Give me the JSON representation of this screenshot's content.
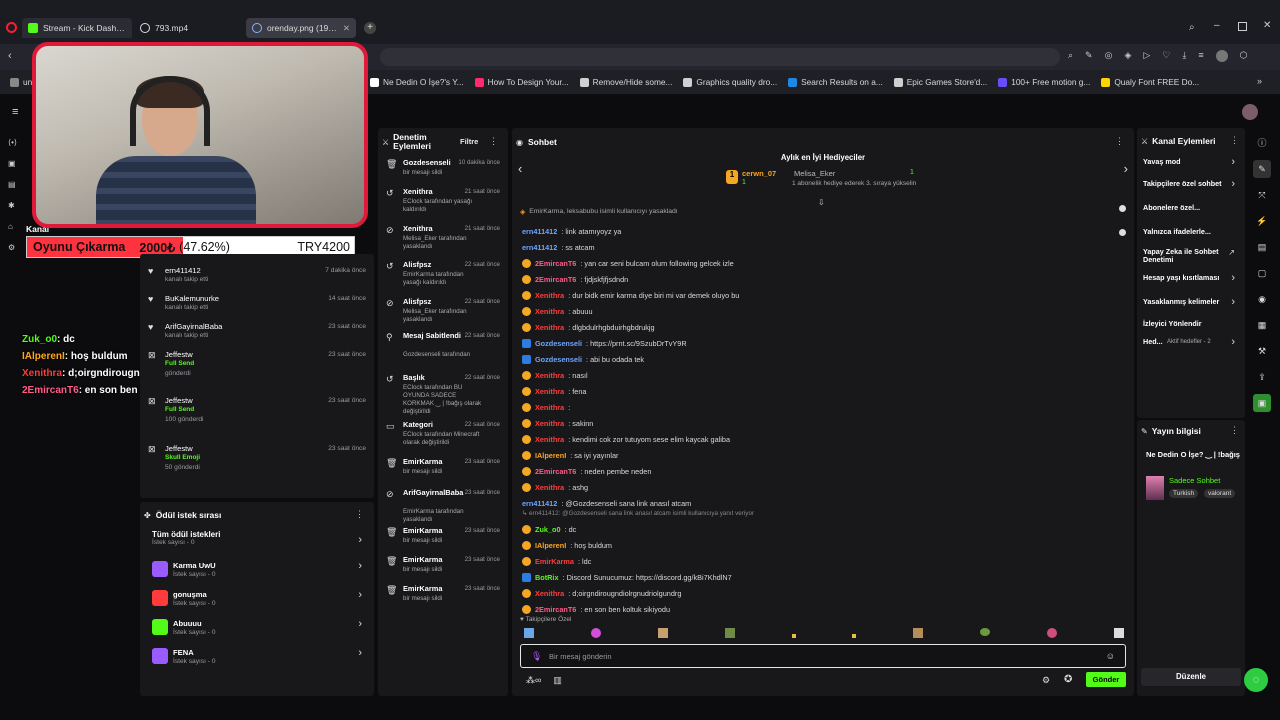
{
  "browser": {
    "tabs": [
      {
        "title": "Stream - Kick Dashboard",
        "color": "#53fc18"
      },
      {
        "title": "793.mp4",
        "color": "#ffffff"
      },
      {
        "title": "orenday.png (1917×10",
        "color": "#8ab4f8"
      }
    ],
    "new_tab": "+",
    "bookmarks": [
      {
        "label": "un",
        "color": "#888888"
      },
      {
        "label": "Ne Dedin O İşe?'s Y...",
        "color": "#ffffff"
      },
      {
        "label": "How To Design Your...",
        "color": "#ff2b6e"
      },
      {
        "label": "Remove/Hide some...",
        "color": "#d0d0d0"
      },
      {
        "label": "Graphics quality dro...",
        "color": "#d0d0d0"
      },
      {
        "label": "Search Results on a...",
        "color": "#1e88e5"
      },
      {
        "label": "Epic Games Store'd...",
        "color": "#cfcfcf"
      },
      {
        "label": "100+ Free motion g...",
        "color": "#6a4cff"
      },
      {
        "label": "Qualy Font FREE Do...",
        "color": "#ffd500"
      }
    ]
  },
  "overlay": {
    "goal_title": "Oyunu Çıkarma",
    "goal_amount": "2000₺",
    "goal_percent": "(47.62%)",
    "goal_target": "TRY4200",
    "goal_progress": 0.4762,
    "chat": [
      {
        "user": "Zuk_o0",
        "text": ": dc",
        "color": "#53fc18"
      },
      {
        "user": "IAlperenI",
        "text": ": hoş buldum",
        "color": "#ffa51f"
      },
      {
        "user": "Xenithra",
        "text": ": d;oirgndirougndiolrgnudriolgundrg",
        "color": "#ff3d3d"
      },
      {
        "user": "2EmircanT6",
        "text": ": en son ben koltuk sikiyodu",
        "color": "#ff5c8a"
      }
    ]
  },
  "left_panel": {
    "kanal_label": "Kanal",
    "activity": [
      {
        "user": "ern411412",
        "action": "kanalı takip etti",
        "extra": "",
        "time": "7 dakika önce",
        "icon": "heart"
      },
      {
        "user": "BuKalemunurke",
        "action": "kanalı takip etti",
        "extra": "",
        "time": "14 saat önce",
        "icon": "heart"
      },
      {
        "user": "ArifGayirnalBaba",
        "action": "kanalı takip etti",
        "extra": "",
        "time": "23 saat önce",
        "icon": "heart"
      },
      {
        "user": "Jeffestw",
        "action": "Full Send",
        "extra": "gönderdi",
        "time": "23 saat önce",
        "icon": "x"
      },
      {
        "user": "Jeffestw",
        "action": "Full Send",
        "extra": "100 gönderdi",
        "time": "23 saat önce",
        "icon": "x"
      },
      {
        "user": "Jeffestw",
        "action": "Skull Emoji",
        "extra": "50 gönderdi",
        "time": "23 saat önce",
        "icon": "x"
      }
    ],
    "rewards_title": "Ödül istek sırası",
    "rewards_all": "Tüm ödül istekleri",
    "rewards_all_sub": "İstek sayısı - 0",
    "rewards": [
      {
        "name": "Karma UwU",
        "sub": "İstek sayısı - 0",
        "color": "#9b5cff"
      },
      {
        "name": "gonuşma",
        "sub": "İstek sayısı - 0",
        "color": "#ff3b3b"
      },
      {
        "name": "Abuuuu",
        "sub": "İstek sayısı - 0",
        "color": "#53fc18"
      },
      {
        "name": "FENA",
        "sub": "İstek sayısı - 0",
        "color": "#9b5cff"
      }
    ]
  },
  "moderation": {
    "title": "Denetim Eylemleri",
    "filter": "Filtre",
    "items": [
      {
        "title": "Gozdesenseli",
        "desc": "bir mesajı sildi",
        "time": "10 dakika önce",
        "icon": "trash"
      },
      {
        "title": "Xenithra",
        "desc": "EClock tarafından yasağı kaldırıldı",
        "time": "21 saat önce",
        "icon": "undo"
      },
      {
        "title": "Xenithra",
        "desc": "Melisa_Eker tarafından yasaklandı",
        "time": "21 saat önce",
        "icon": "ban"
      },
      {
        "title": "Alisfpsz",
        "desc": "EmirKarma tarafından yasağı kaldırıldı",
        "time": "22 saat önce",
        "icon": "undo"
      },
      {
        "title": "Alisfpsz",
        "desc": "Melisa_Eker tarafından yasaklandı",
        "time": "22 saat önce",
        "icon": "ban"
      },
      {
        "title": "Mesaj Sabitlendi",
        "desc": "Gozdesenseli tarafından",
        "time": "22 saat önce",
        "icon": "pin"
      },
      {
        "title": "Başlık",
        "desc": "EClock tarafından BU OYUNDA SADECE KORKMAK ‿ | !bağış olarak değiştirildi",
        "time": "22 saat önce",
        "icon": "undo"
      },
      {
        "title": "Kategori",
        "desc": "EClock tarafından Minecraft olarak değiştirildi",
        "time": "22 saat önce",
        "icon": "tv"
      },
      {
        "title": "EmirKarma",
        "desc": "bir mesajı sildi",
        "time": "23 saat önce",
        "icon": "trash"
      },
      {
        "title": "ArifGayirnalBaba",
        "desc": "EmirKarma tarafından yasaklandı",
        "time": "23 saat önce",
        "icon": "ban"
      },
      {
        "title": "EmirKarma",
        "desc": "bir mesajı sildi",
        "time": "23 saat önce",
        "icon": "trash"
      },
      {
        "title": "EmirKarma",
        "desc": "bir mesajı sildi",
        "time": "23 saat önce",
        "icon": "trash"
      },
      {
        "title": "EmirKarma",
        "desc": "bir mesajı sildi",
        "time": "23 saat önce",
        "icon": "trash"
      }
    ]
  },
  "chat": {
    "title": "Sohbet",
    "gifter_title": "Aylık en İyi Hediyeciler",
    "top1_user": "cerwn_07",
    "top1_count": "1",
    "top2_user": "Melisa_Eker",
    "top2_count": "1",
    "top2_note": "1 abonelik hediye ederek 3. sıraya yükselin",
    "system": "EmirKarma, leksabubu isimli kullanıcıyı yasakladı",
    "messages": [
      {
        "user": "ern411412",
        "text": ": link atamıyoyz ya",
        "color": "u-blue"
      },
      {
        "user": "ern411412",
        "text": ": ss atcam",
        "color": "u-blue"
      },
      {
        "user": "2EmircanT6",
        "text": ": yan car seni bulcam olum following gelcek izle",
        "color": "u-pink"
      },
      {
        "user": "2EmircanT6",
        "text": ": fjdjskfjfjsdndn",
        "color": "u-pink"
      },
      {
        "user": "Xenithra",
        "text": ": dur bidk emir karma diye biri mi var demek oluyo bu",
        "color": "u-red"
      },
      {
        "user": "Xenithra",
        "text": ": abuuu",
        "color": "u-red"
      },
      {
        "user": "Xenithra",
        "text": ": dlgbdulrhgbduirhgbdrukjg",
        "color": "u-red"
      },
      {
        "user": "Gozdesenseli",
        "text": ": https://prnt.sc/9SzubDrTvY9R",
        "color": "u-blue"
      },
      {
        "user": "Gozdesenseli",
        "text": ": abi bu odada tek",
        "color": "u-blue"
      },
      {
        "user": "Xenithra",
        "text": ": nasıl",
        "color": "u-red"
      },
      {
        "user": "Xenithra",
        "text": ": fena",
        "color": "u-red"
      },
      {
        "user": "Xenithra",
        "text": ":",
        "color": "u-red"
      },
      {
        "user": "Xenithra",
        "text": ": sakinn",
        "color": "u-red"
      },
      {
        "user": "Xenithra",
        "text": ": kendimi cok zor tutuyom sese elim kaycak galiba",
        "color": "u-red"
      },
      {
        "user": "IAlperenI",
        "text": ": sa iyi yayınlar",
        "color": "u-orange"
      },
      {
        "user": "2EmircanT6",
        "text": ": neden pembe neden",
        "color": "u-pink"
      },
      {
        "user": "Xenithra",
        "text": ": ashg",
        "color": "u-red"
      },
      {
        "user": "ern411412",
        "text": ": @Gozdesenseli sana link anasıl atcam",
        "color": "u-blue"
      }
    ],
    "reply_note": "ern411412: @Gozdesenseli sana link anasıl atcam isimli kullanıcıya yanıt veriyor",
    "messages2": [
      {
        "user": "Zuk_o0",
        "text": ": dc",
        "color": "u-green"
      },
      {
        "user": "IAlperenI",
        "text": ": hoş buldum",
        "color": "u-orange"
      },
      {
        "user": "EmirKarma",
        "text": ": ldc",
        "color": "u-red"
      },
      {
        "user": "BotRix",
        "text": ": Discord Sunucumuz: https://discord.gg/kBi7KhdlN7",
        "color": "u-green"
      },
      {
        "user": "Xenithra",
        "text": ": d;oirgndirougndiolrgnudriolgundrg",
        "color": "u-red"
      },
      {
        "user": "2EmircanT6",
        "text": ": en son ben koltuk sikiyodu",
        "color": "u-pink"
      }
    ],
    "followers_only": "Takipçilere Özel",
    "input_placeholder": "Bir mesaj gönderin",
    "send": "Gönder"
  },
  "channel_actions": {
    "title": "Kanal Eylemleri",
    "items": [
      {
        "label": "Yavaş mod",
        "control": "chevron"
      },
      {
        "label": "Takipçilere özel sohbet",
        "control": "chevron"
      },
      {
        "label": "Abonelere özel...",
        "control": "toggle"
      },
      {
        "label": "Yalnızca ifadelerle...",
        "control": "toggle"
      },
      {
        "label": "Yapay Zeka ile Sohbet Denetimi",
        "control": "link"
      },
      {
        "label": "Hesap yaşı kısıtlaması",
        "control": "chevron"
      },
      {
        "label": "Yasaklanmış kelimeler",
        "control": "chevron"
      },
      {
        "label": "İzleyici Yönlendir",
        "control": "none"
      },
      {
        "label": "Hed...",
        "control": "chevron"
      }
    ],
    "active_gifts": "Aktif hedefler - 2"
  },
  "stream_info": {
    "title": "Yayın bilgisi",
    "stream_title": "Ne Dedin O İşe? ‿ | !bağış",
    "mode": "Sadece Sohbet",
    "tags": [
      "Turkish",
      "valorant"
    ],
    "edit": "Düzenle"
  }
}
